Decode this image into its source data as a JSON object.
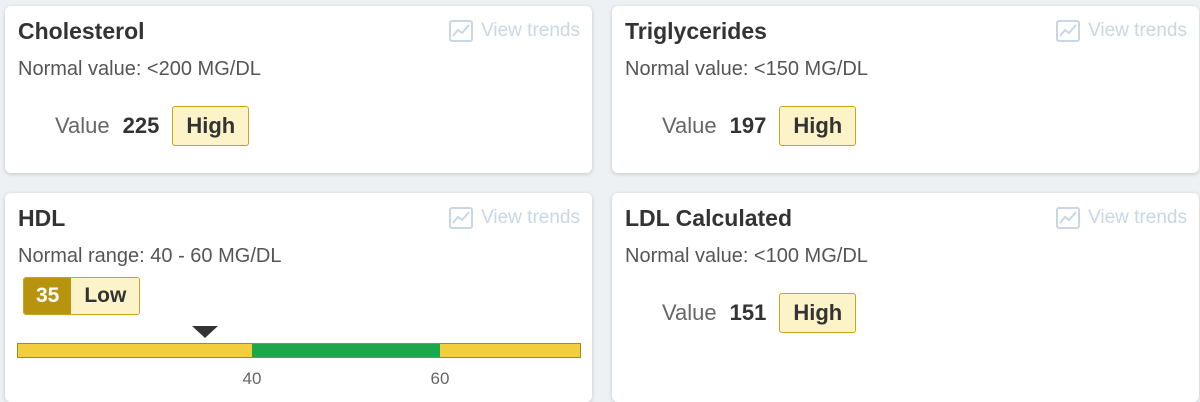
{
  "trends_label": "View trends",
  "cards": {
    "cholesterol": {
      "title": "Cholesterol",
      "normal": "Normal value: <200 MG/DL",
      "value_label": "Value",
      "value": "225",
      "status": "High"
    },
    "triglycerides": {
      "title": "Triglycerides",
      "normal": "Normal value: <150 MG/DL",
      "value_label": "Value",
      "value": "197",
      "status": "High"
    },
    "hdl": {
      "title": "HDL",
      "normal": "Normal range: 40 - 60 MG/DL",
      "value": "35",
      "status": "Low",
      "range": {
        "min": 15,
        "low": 40,
        "high": 60,
        "max": 75,
        "value": 35
      },
      "ticks": [
        "40",
        "60"
      ]
    },
    "ldl": {
      "title": "LDL Calculated",
      "normal": "Normal value: <100 MG/DL",
      "value_label": "Value",
      "value": "151",
      "status": "High"
    }
  },
  "colors": {
    "high_badge_bg": "#fdf3c8",
    "low_value_bg": "#b8930e",
    "range_out": "#f2cd3c",
    "range_normal": "#1aa84b",
    "trends_text": "#c9d6e3"
  },
  "icons": {
    "trends": "trend-chart-icon"
  }
}
